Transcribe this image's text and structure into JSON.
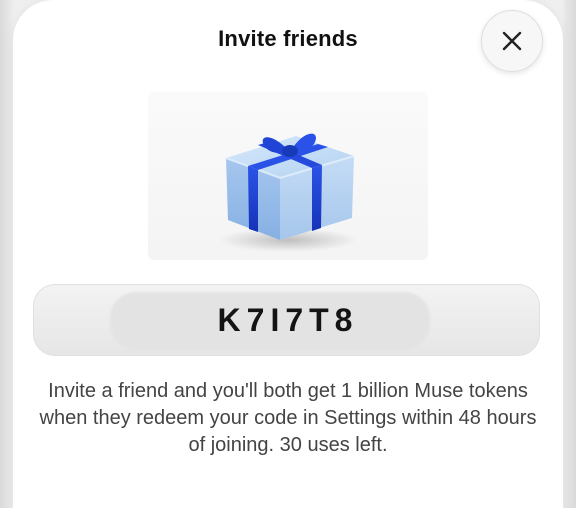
{
  "modal": {
    "title": "Invite friends",
    "close_icon": "close-icon",
    "illustration_icon": "gift-box-icon",
    "code": "K7I7T8",
    "description": "Invite a friend and you'll both get 1 billion Muse tokens when they redeem your code in Settings within 48 hours of joining. 30 uses left."
  },
  "colors": {
    "ribbon": "#1a3fd6",
    "box": "#a9c9ef"
  }
}
